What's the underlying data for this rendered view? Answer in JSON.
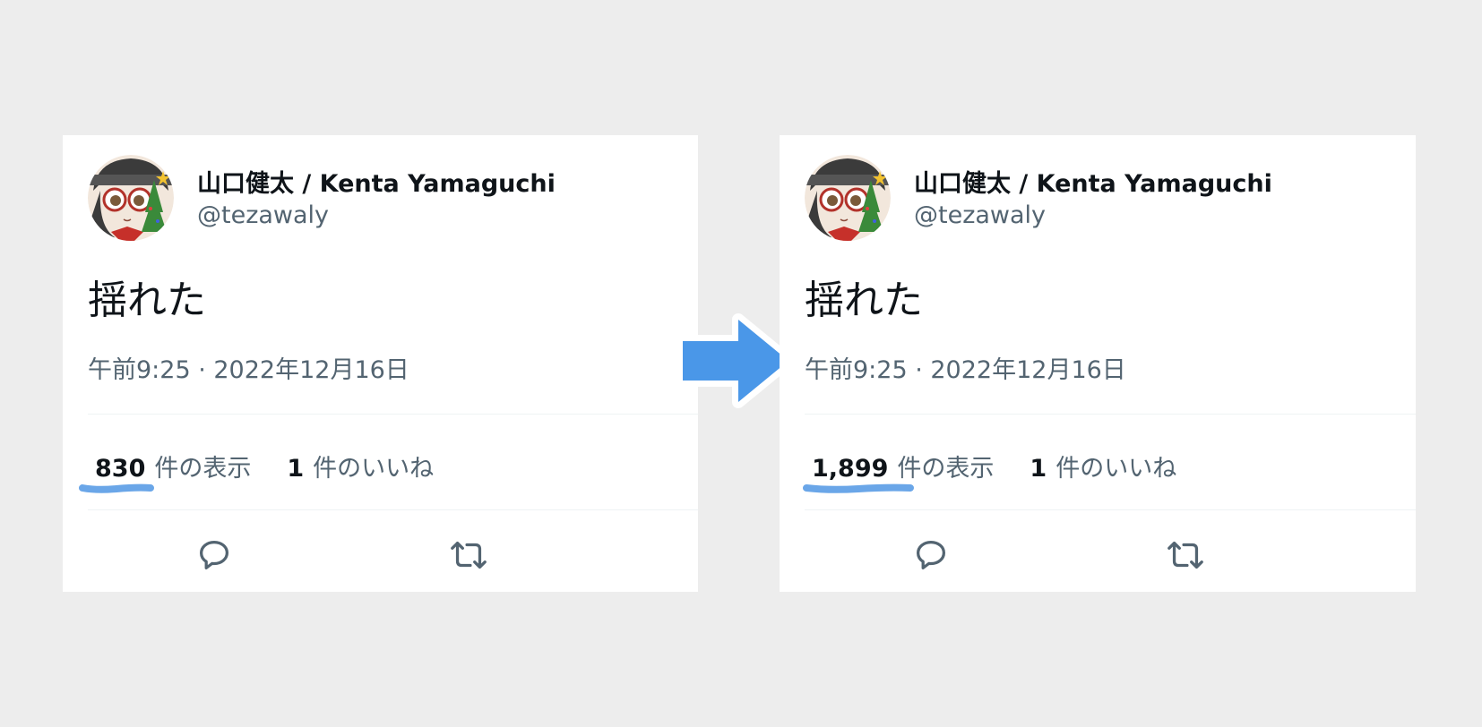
{
  "colors": {
    "page_background": "#ededed",
    "card_background": "#ffffff",
    "primary_text": "#0f1419",
    "secondary_text": "#536471",
    "arrow_fill": "#4a97e8",
    "highlight_stroke": "#6aa6e8"
  },
  "tweets": [
    {
      "author_name": "山口健太 / Kenta Yamaguchi",
      "author_handle": "@tezawaly",
      "text": "揺れた",
      "timestamp": "午前9:25 · 2022年12月16日",
      "views_count": "830",
      "views_label": "件の表示",
      "likes_count": "1",
      "likes_label": "件のいいね"
    },
    {
      "author_name": "山口健太 / Kenta Yamaguchi",
      "author_handle": "@tezawaly",
      "text": "揺れた",
      "timestamp": "午前9:25 · 2022年12月16日",
      "views_count": "1,899",
      "views_label": "件の表示",
      "likes_count": "1",
      "likes_label": "件のいいね"
    }
  ],
  "icons": {
    "reply": "reply-icon",
    "retweet": "retweet-icon",
    "arrow": "arrow-right-icon",
    "avatar": "avatar-anime-character"
  }
}
